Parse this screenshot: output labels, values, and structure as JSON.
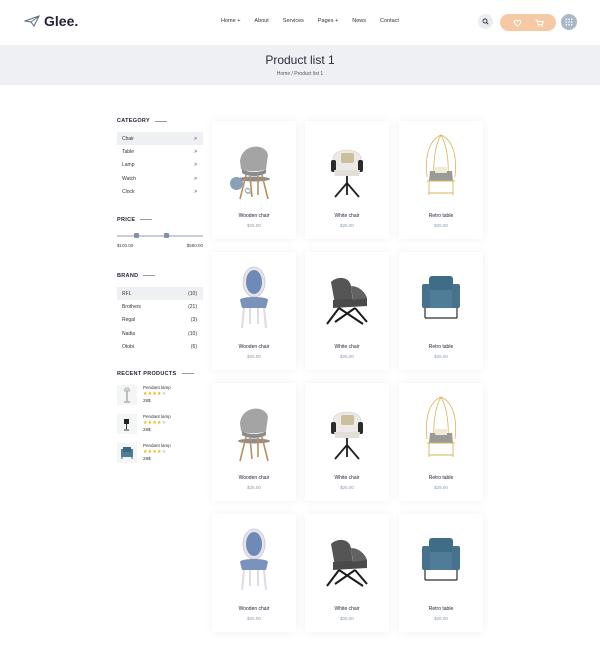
{
  "brand": {
    "name": "Glee."
  },
  "nav": [
    "Home +",
    "About",
    "Services",
    "Pages +",
    "News",
    "Contact"
  ],
  "banner": {
    "title": "Product list 1",
    "crumb_home": "Home",
    "crumb_sep": "/",
    "crumb_current": "Product list 1"
  },
  "sidebar": {
    "category_title": "CATEGORY",
    "categories": [
      {
        "label": "Chair",
        "arrow": ">"
      },
      {
        "label": "Table",
        "arrow": ">"
      },
      {
        "label": "Lamp",
        "arrow": ">"
      },
      {
        "label": "Watch",
        "arrow": ">"
      },
      {
        "label": "Clock",
        "arrow": ">"
      }
    ],
    "price_title": "PRICE",
    "price_min": "$100.00",
    "price_max": "$580.00",
    "price_low_fraction": 0.23,
    "price_high_fraction": 0.57,
    "brand_title": "BRAND",
    "brands": [
      {
        "label": "RFL",
        "count": "(10)"
      },
      {
        "label": "Brothers",
        "count": "(21)"
      },
      {
        "label": "Regal",
        "count": "(3)"
      },
      {
        "label": "Nadia",
        "count": "(10)"
      },
      {
        "label": "Otobi",
        "count": "(6)"
      }
    ],
    "recent_title": "RECENT PRODUCTS",
    "recent": [
      {
        "name": "Pendant lamp",
        "price": "28$",
        "rating": 4
      },
      {
        "name": "Pendant lamp",
        "price": "28$",
        "rating": 4
      },
      {
        "name": "Pendant lamp",
        "price": "28$",
        "rating": 4
      }
    ]
  },
  "products": [
    {
      "name": "Wooden chair",
      "price": "$25.00",
      "kind": "wooden"
    },
    {
      "name": "White chair",
      "price": "$25.00",
      "kind": "white"
    },
    {
      "name": "Retro table",
      "price": "$25.00",
      "kind": "retro"
    },
    {
      "name": "Wooden chair",
      "price": "$25.00",
      "kind": "baroque"
    },
    {
      "name": "White chair",
      "price": "$25.00",
      "kind": "lounge"
    },
    {
      "name": "Retro table",
      "price": "$25.00",
      "kind": "armchair"
    },
    {
      "name": "Wooden chair",
      "price": "$25.00",
      "kind": "wooden"
    },
    {
      "name": "White chair",
      "price": "$25.00",
      "kind": "white"
    },
    {
      "name": "Retro table",
      "price": "$25.00",
      "kind": "retro"
    },
    {
      "name": "Wooden chair",
      "price": "$25.00",
      "kind": "baroque"
    },
    {
      "name": "White chair",
      "price": "$25.00",
      "kind": "lounge"
    },
    {
      "name": "Retro table",
      "price": "$25.00",
      "kind": "armchair"
    }
  ],
  "colors": {
    "accent": "#f6c9a5",
    "price": "#8a9bb0",
    "banner": "#eef0f3",
    "chair_blue": "#4f7d98"
  }
}
